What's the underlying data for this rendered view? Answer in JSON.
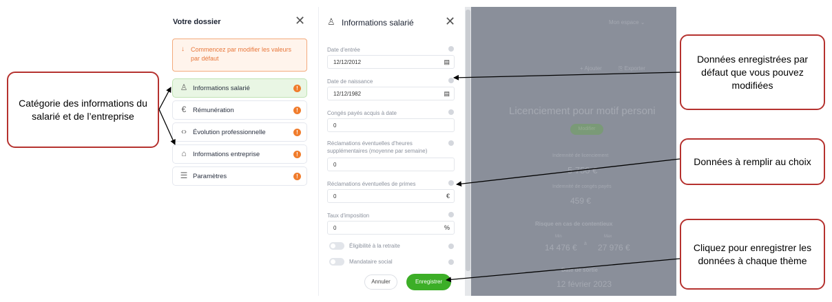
{
  "left_panel": {
    "title": "Votre dossier",
    "warning": "Commencez par modifier les valeurs par défaut",
    "items": [
      {
        "label": "Informations salarié",
        "badge": "!"
      },
      {
        "label": "Rémunération",
        "badge": "!"
      },
      {
        "label": "Évolution professionnelle",
        "badge": "!"
      },
      {
        "label": "Informations entreprise",
        "badge": "!"
      },
      {
        "label": "Paramètres",
        "badge": "!"
      }
    ]
  },
  "middle_panel": {
    "title": "Informations salarié",
    "fields": {
      "date_entree": {
        "label": "Date d'entrée",
        "value": "12/12/2012"
      },
      "date_naissance": {
        "label": "Date de naissance",
        "value": "12/12/1982"
      },
      "conges": {
        "label": "Congés payés acquis à date",
        "value": "0"
      },
      "heures_sup": {
        "label": "Réclamations éventuelles d'heures supplémentaires (moyenne par semaine)",
        "value": "0"
      },
      "primes": {
        "label": "Réclamations éventuelles de primes",
        "value": "0",
        "suffix": "€"
      },
      "taux": {
        "label": "Taux d'imposition",
        "value": "0",
        "suffix": "%"
      }
    },
    "toggles": {
      "retraite": "Éligibilité à la retraite",
      "mandataire": "Mandataire social"
    },
    "buttons": {
      "cancel": "Annuler",
      "save": "Enregistrer"
    }
  },
  "right_panel": {
    "menu": "Mon espace ⌄",
    "action_1": "+ Ajouter",
    "action_2": "⎘ Exporter",
    "heading": "Licenciement pour motif personi",
    "badge": "Modifier",
    "indemnite_label": "Indemnité de licenciement",
    "indemnite_value": "5 750 €",
    "conges_label": "Indemnité de congés payés",
    "conges_value": "459 €",
    "risque_label": "Risque en cas de contentieux",
    "risque_min_label": "Min",
    "risque_max_label": "Max",
    "risque_min": "14 476 €",
    "risque_sep": "à",
    "risque_max": "27 976 €",
    "sortie_label": "Date de sortie",
    "sortie_value": "12 février 2023"
  },
  "callouts": {
    "categories": "Catégorie des informations du salarié et de l’entreprise",
    "defaults": "Données enregistrées par défaut que vous pouvez modifiées",
    "optional": "Données à remplir au choix",
    "save": "Cliquez pour enregistrer les données à chaque thème"
  },
  "colors": {
    "accent_green": "#3cae27",
    "warning_orange": "#e8773b",
    "callout_border": "#b5312e"
  },
  "icons": [
    "close-icon",
    "person-icon",
    "euro-icon",
    "career-icon",
    "bank-icon",
    "settings-icon",
    "calendar-icon",
    "info-icon"
  ]
}
